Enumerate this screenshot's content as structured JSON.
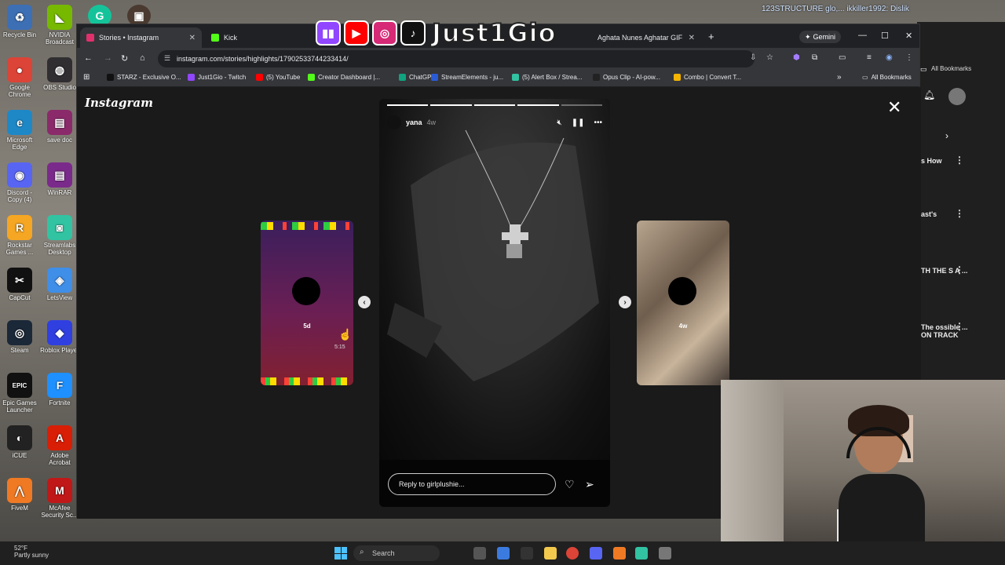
{
  "desktop": {
    "left_icons": [
      {
        "label": "Recycle Bin",
        "glyph": "♻",
        "color": "#3d6fb5"
      },
      {
        "label": "Google Chrome",
        "glyph": "●",
        "color": "#db4437"
      },
      {
        "label": "Microsoft Edge",
        "glyph": "e",
        "color": "#1e88c7"
      },
      {
        "label": "Discord - Copy (4)",
        "glyph": "◉",
        "color": "#5865f2"
      },
      {
        "label": "Rockstar Games ...",
        "glyph": "R",
        "color": "#f5a623"
      },
      {
        "label": "CapCut",
        "glyph": "✂",
        "color": "#111111"
      },
      {
        "label": "Steam",
        "glyph": "◎",
        "color": "#1b2838"
      },
      {
        "label": "Epic Games Launcher",
        "glyph": "EPIC",
        "color": "#111111"
      },
      {
        "label": "iCUE",
        "glyph": "◐",
        "color": "#222222"
      },
      {
        "label": "FiveM",
        "glyph": "⋀",
        "color": "#f07a24"
      }
    ],
    "right_icons": [
      {
        "label": "NVIDIA Broadcast",
        "glyph": "◣",
        "color": "#76b900"
      },
      {
        "label": "OBS Studio",
        "glyph": "◍",
        "color": "#302e31"
      },
      {
        "label": "save doc",
        "glyph": "▤",
        "color": "#8b2a6b"
      },
      {
        "label": "WinRAR",
        "glyph": "▤",
        "color": "#7a2a8a"
      },
      {
        "label": "Streamlabs Desktop",
        "glyph": "◙",
        "color": "#31c3a2"
      },
      {
        "label": "LetsView",
        "glyph": "◈",
        "color": "#3f8ee8"
      },
      {
        "label": "Roblox Player",
        "glyph": "◆",
        "color": "#2f3fe0"
      },
      {
        "label": "Fortnite",
        "glyph": "F",
        "color": "#1e90ff"
      },
      {
        "label": "Adobe Acrobat",
        "glyph": "A",
        "color": "#d81e05"
      },
      {
        "label": "McAfee Security Sc...",
        "glyph": "M",
        "color": "#c01818"
      }
    ],
    "top_icons": [
      {
        "glyph": "G",
        "color": "#15c39a"
      },
      {
        "glyph": "▣",
        "color": "#4a3a30"
      }
    ]
  },
  "overlay": {
    "name": "Just1Gio",
    "logos": [
      {
        "name": "twitch-logo-icon",
        "glyph": "▮▮",
        "color": "#9146ff"
      },
      {
        "name": "youtube-logo-icon",
        "glyph": "▶",
        "color": "#ff0000"
      },
      {
        "name": "instagram-logo-icon",
        "glyph": "◎",
        "color": "#d62976"
      },
      {
        "name": "tiktok-logo-icon",
        "glyph": "♪",
        "color": "#111111"
      }
    ]
  },
  "browser": {
    "tabs": [
      {
        "title": "Stories • Instagram",
        "icon_color": "#e1306c",
        "active": true
      },
      {
        "title": "Kick",
        "icon_color": "#53fc18",
        "active": false
      },
      {
        "title": "Aghata Nunes Aghatar GIF - Ag",
        "icon_color": "#555555",
        "active": false
      }
    ],
    "gemini_label": "Gemini",
    "url": "instagram.com/stories/highlights/17902533744233414/",
    "bookmarks": [
      {
        "label": "STARZ - Exclusive O...",
        "icon_color": "#111111"
      },
      {
        "label": "Just1Gio - Twitch",
        "icon_color": "#9146ff"
      },
      {
        "label": "(5) YouTube",
        "icon_color": "#ff0000"
      },
      {
        "label": "Creator Dashboard |...",
        "icon_color": "#53fc18"
      },
      {
        "label": "ChatGPT",
        "icon_color": "#10a37f"
      },
      {
        "label": "StreamElements - ju...",
        "icon_color": "#2a5bd7"
      },
      {
        "label": "(5) Alert Box / Strea...",
        "icon_color": "#31c3a2"
      },
      {
        "label": "Opus Clip - AI-pow...",
        "icon_color": "#222222"
      },
      {
        "label": "Combo | Convert T...",
        "icon_color": "#f5b400"
      }
    ],
    "all_bookmarks": "All Bookmarks"
  },
  "instagram": {
    "logo": "Instagram",
    "story": {
      "username": "yana",
      "age": "4w",
      "progress_segments": 5,
      "segments_completed": 4,
      "reply_placeholder": "Reply to girlplushie..."
    },
    "left_story_age": "5d",
    "left_story_time": "5:15",
    "right_story_age": "4w"
  },
  "right_window": {
    "all_bookmarks": "All Bookmarks",
    "items": [
      "s How",
      "ast's",
      "TH THE S A ...",
      "The ossible ... ON TRACK"
    ]
  },
  "top_right_user": "123STRUCTURE glo,... ikkiller1992: Dislik",
  "taskbar": {
    "weather_temp": "52°F",
    "weather_desc": "Partly sunny",
    "search_label": "Search"
  }
}
